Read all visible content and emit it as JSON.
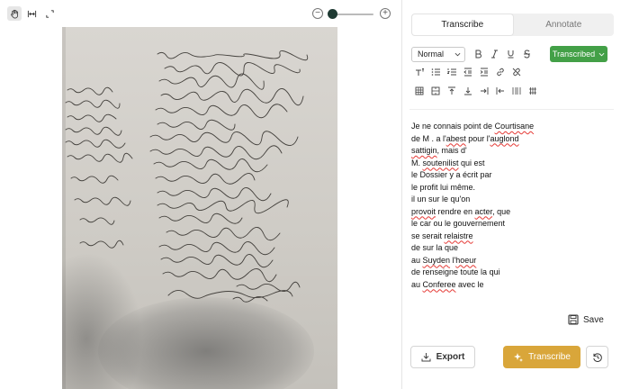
{
  "viewer": {
    "tools": [
      {
        "icon": "hand-icon",
        "active": true
      },
      {
        "icon": "fit-width-icon",
        "active": false
      },
      {
        "icon": "fullscreen-icon",
        "active": false
      }
    ],
    "zoom": {
      "minus_label": "−",
      "plus_label": "+",
      "value": 0.05
    }
  },
  "panel": {
    "tabs": [
      {
        "label": "Transcribe",
        "active": true
      },
      {
        "label": "Annotate",
        "active": false
      }
    ],
    "format": {
      "block_style": "Normal",
      "status_label": "Transcribed",
      "status_color": "#43a047"
    },
    "transcription": [
      "Je ne connais point de Courtisane",
      "de M . a l'abest pour l'auglond",
      "sattigin, mais d'",
      "M. soutenilist qui est",
      "le Dossier y a écrit par",
      "le profit lui même.",
      "il un sur le qu'on",
      "provoit rendre en acter, que",
      "le car ou le gouvernement",
      "se serait relaistre",
      "de sur la que",
      "au Suyden l'hoeur",
      "de renseigne toute la qui",
      "au Conferee avec le"
    ],
    "save_label": "Save",
    "export_label": "Export",
    "transcribe_label": "Transcribe",
    "accent_color": "#d9a63a"
  }
}
